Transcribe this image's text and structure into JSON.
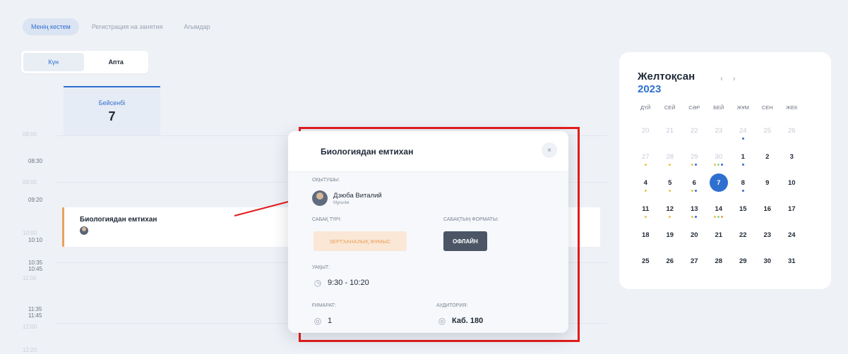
{
  "tabs": [
    {
      "label": "Менің кестем",
      "active": true
    },
    {
      "label": "Регистрация на занятия",
      "active": false
    },
    {
      "label": "Агымдар",
      "active": false
    }
  ],
  "view_toggle": {
    "day": "Күн",
    "week": "Апта"
  },
  "day_column": {
    "name": "Бейсенбі",
    "number": "7"
  },
  "time_labels": {
    "t0": "08:00",
    "t1": "08:30",
    "t2": "09:00",
    "t3": "09:20",
    "t4": "10:00",
    "t5": "10:10",
    "t6": "10:35",
    "t7": "10:45",
    "t8": "11:00",
    "t9": "11:35",
    "t10": "11:45",
    "t11": "12:00",
    "t12": "12:20"
  },
  "event": {
    "title": "Биологиядан емтихан",
    "accent": "#e8a15a"
  },
  "calendar": {
    "month": "Желтоқсан",
    "year": "2023",
    "prev_icon": "chevron-left-icon",
    "next_icon": "chevron-right-icon",
    "prev": "‹",
    "next": "›",
    "weekdays": [
      "ДҮЙ",
      "СЕЙ",
      "СӘР",
      "БЕЙ",
      "ЖҰМ",
      "СЕН",
      "ЖЕК"
    ],
    "accent": "#2f6fd0"
  },
  "modal": {
    "title": "Биологиядан емтихан",
    "close": "×",
    "teacher_label": "ОҚЫТУШЫ:",
    "teacher_name": "Дзюба Виталий",
    "teacher_role": "Мұғалім",
    "type_label": "САБАҚ ТҮРІ:",
    "type_value": "ЗЕРТХАНАЛЫҚ ЖҰМЫС",
    "format_label": "САБАҚТЫҢ ФОРМАТЫ:",
    "format_value": "ОФЛАЙН",
    "time_label": "УАҚЫТ:",
    "time_value": "9:30 - 10:20",
    "building_label": "ҒИМАРАТ:",
    "building_value": "1",
    "room_label": "АУДИТОРИЯ:",
    "room_value": "Каб. 180"
  }
}
